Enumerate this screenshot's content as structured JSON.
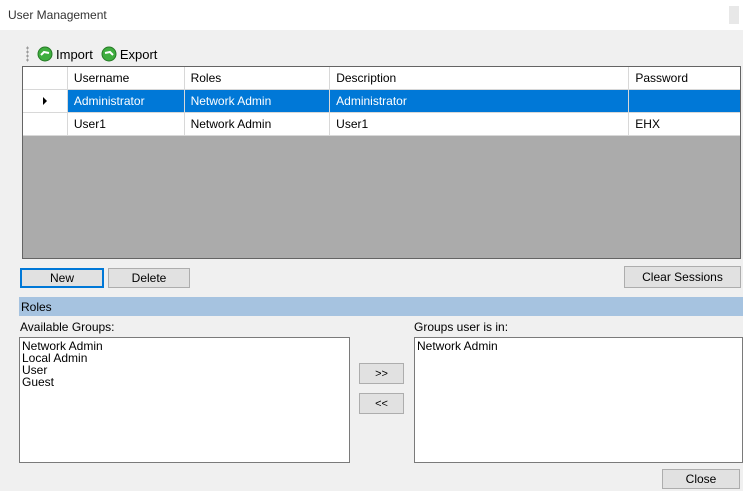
{
  "window": {
    "title": "User Management"
  },
  "toolbar": {
    "import_label": "Import",
    "export_label": "Export"
  },
  "grid": {
    "columns": [
      "",
      "Username",
      "Roles",
      "Description",
      "Password"
    ],
    "rows": [
      {
        "username": "Administrator",
        "roles": "Network Admin",
        "description": "Administrator",
        "password": "",
        "selected": true
      },
      {
        "username": "User1",
        "roles": "Network Admin",
        "description": "User1",
        "password": "EHX",
        "selected": false
      }
    ]
  },
  "buttons": {
    "new": "New",
    "delete": "Delete",
    "clear_sessions": "Clear Sessions",
    "add": ">>",
    "remove": "<<",
    "close": "Close"
  },
  "roles": {
    "section_title": "Roles",
    "available_label": "Available Groups:",
    "available_groups": [
      "Network Admin",
      "Local Admin",
      "User",
      "Guest"
    ],
    "member_label": "Groups user is in:",
    "member_groups": [
      "Network Admin"
    ]
  },
  "colors": {
    "selection": "#0078d7",
    "section_header": "#a6c3e0",
    "icon_green": "#3fae3f"
  }
}
